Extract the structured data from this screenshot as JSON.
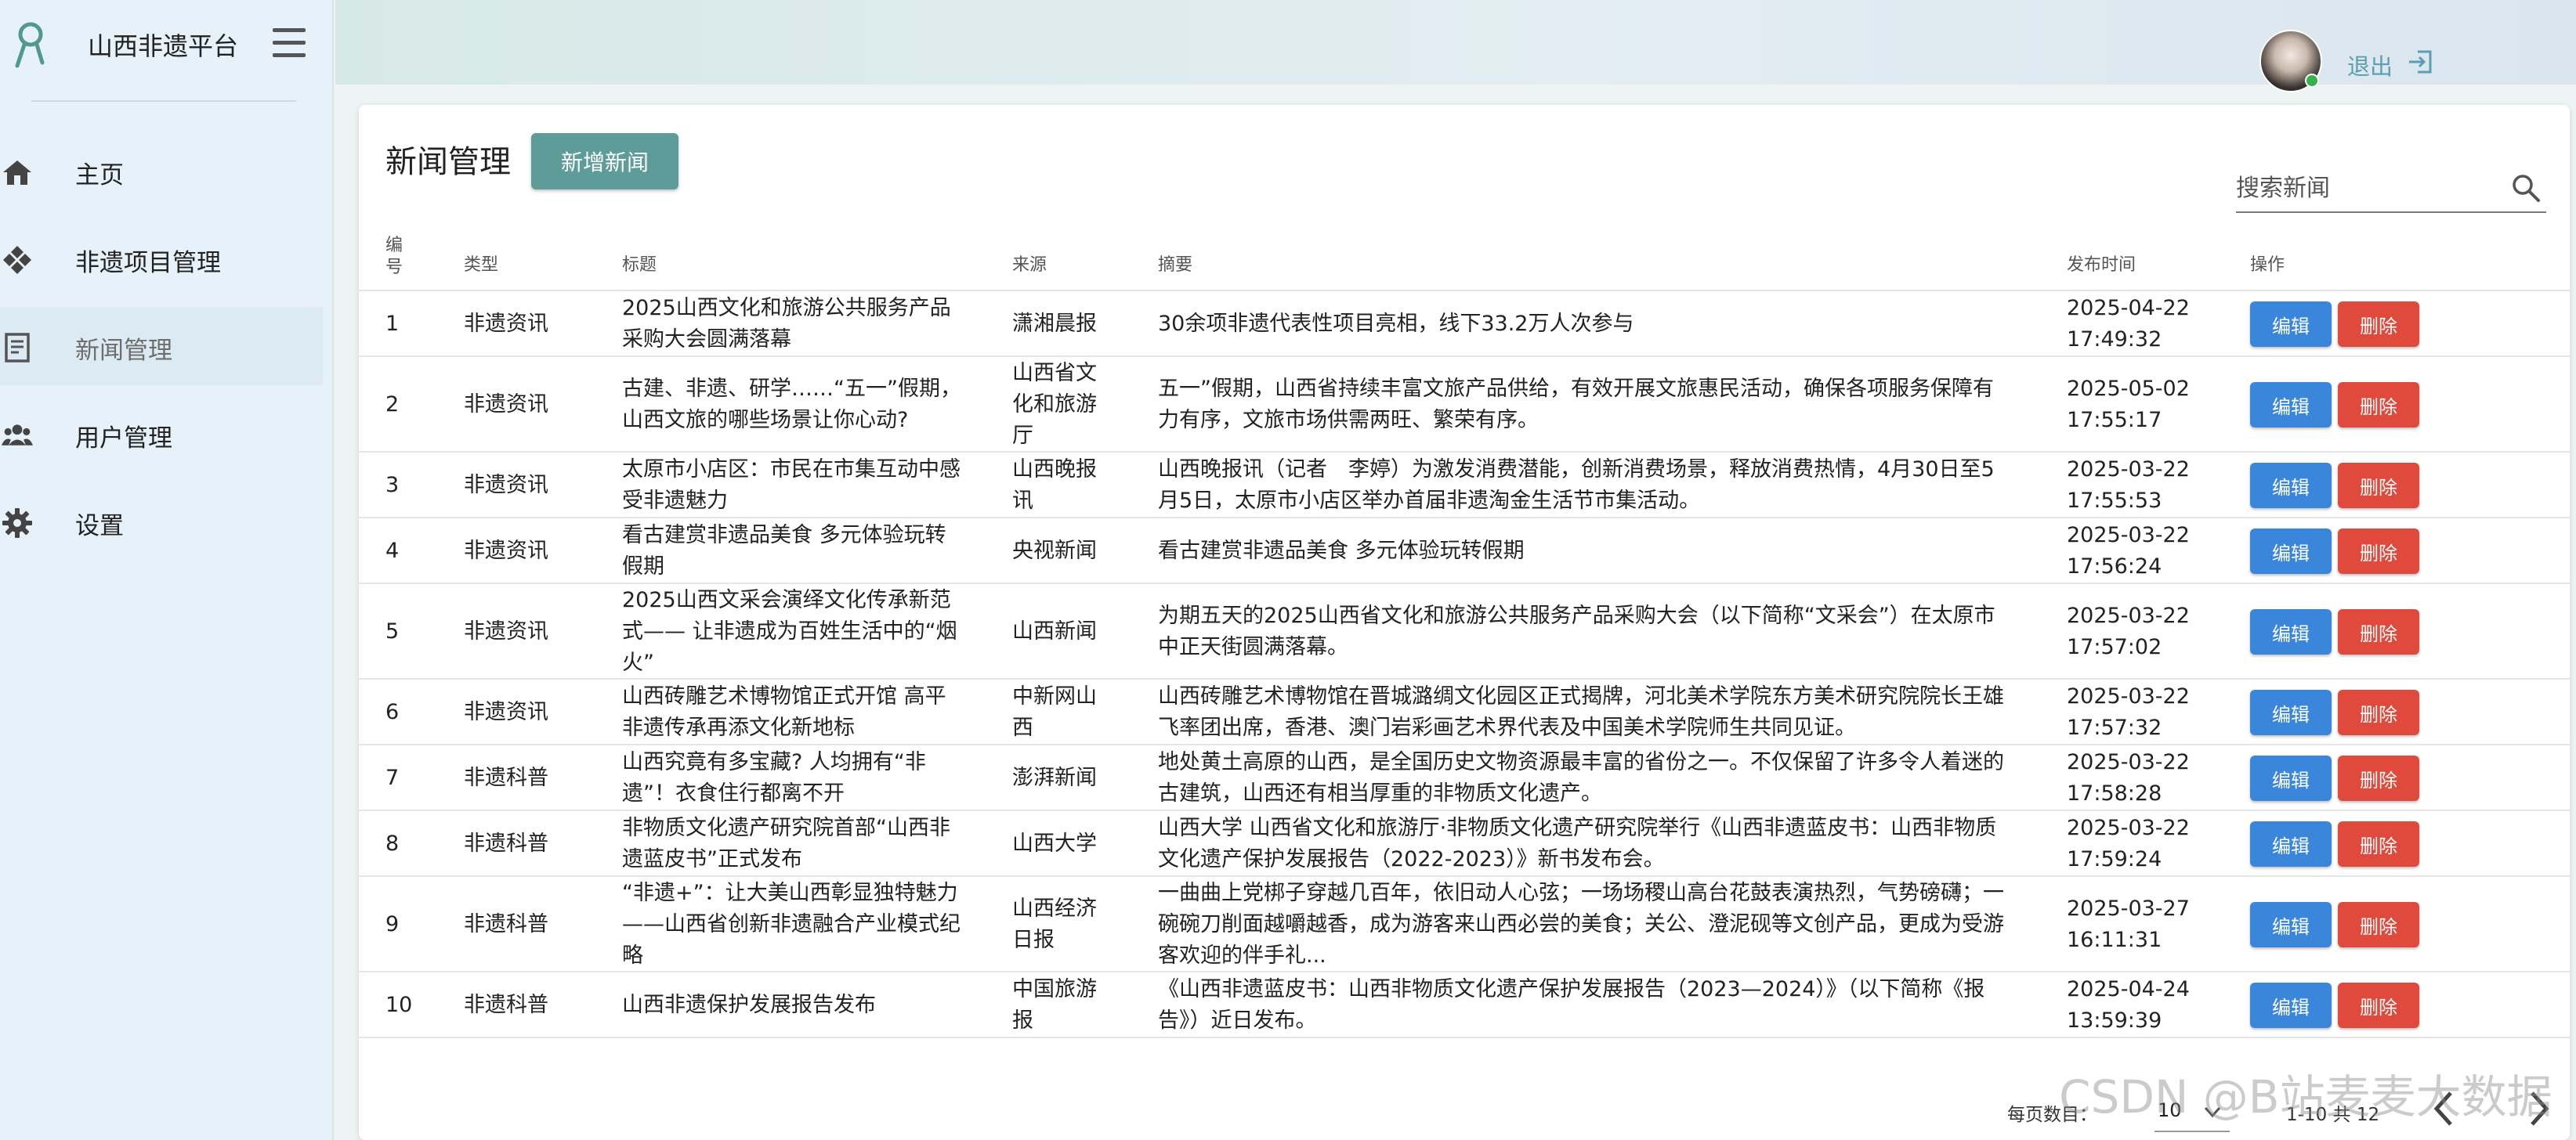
{
  "app": {
    "name": "山西非遗平台"
  },
  "sidebar": {
    "items": [
      {
        "label": "主页",
        "icon": "home-icon"
      },
      {
        "label": "非遗项目管理",
        "icon": "diamond-grid-icon"
      },
      {
        "label": "新闻管理",
        "icon": "news-icon"
      },
      {
        "label": "用户管理",
        "icon": "users-icon"
      },
      {
        "label": "设置",
        "icon": "gear-icon"
      }
    ],
    "active_index": 2
  },
  "topbar": {
    "logout_label": "退出"
  },
  "page": {
    "title": "新闻管理",
    "add_button": "新增新闻",
    "search_placeholder": "搜索新闻"
  },
  "table": {
    "headers": {
      "id": "编号",
      "type": "类型",
      "title": "标题",
      "source": "来源",
      "summary": "摘要",
      "time": "发布时间",
      "ops": "操作"
    },
    "edit_label": "编辑",
    "delete_label": "删除",
    "rows": [
      {
        "id": "1",
        "type": "非遗资讯",
        "title": "2025山西文化和旅游公共服务产品采购大会圆满落幕",
        "source": "潇湘晨报",
        "summary": "30余项非遗代表性项目亮相，线下33.2万人次参与",
        "time": "2025-04-22 17:49:32"
      },
      {
        "id": "2",
        "type": "非遗资讯",
        "title": "古建、非遗、研学……“五一”假期，山西文旅的哪些场景让你心动?",
        "source": "山西省文化和旅游厅",
        "summary": "五一”假期，山西省持续丰富文旅产品供给，有效开展文旅惠民活动，确保各项服务保障有力有序，文旅市场供需两旺、繁荣有序。",
        "time": "2025-05-02 17:55:17"
      },
      {
        "id": "3",
        "type": "非遗资讯",
        "title": "太原市小店区：市民在市集互动中感受非遗魅力",
        "source": "山西晚报讯",
        "summary": "山西晚报讯（记者　李婷）为激发消费潜能，创新消费场景，释放消费热情，4月30日至5月5日，太原市小店区举办首届非遗淘金生活节市集活动。",
        "time": "2025-03-22 17:55:53"
      },
      {
        "id": "4",
        "type": "非遗资讯",
        "title": "看古建赏非遗品美食 多元体验玩转假期",
        "source": "央视新闻",
        "summary": "看古建赏非遗品美食 多元体验玩转假期",
        "time": "2025-03-22 17:56:24"
      },
      {
        "id": "5",
        "type": "非遗资讯",
        "title": "2025山西文采会演绎文化传承新范式—— 让非遗成为百姓生活中的“烟火”",
        "source": "山西新闻",
        "summary": "为期五天的2025山西省文化和旅游公共服务产品采购大会（以下简称“文采会”）在太原市中正天街圆满落幕。",
        "time": "2025-03-22 17:57:02"
      },
      {
        "id": "6",
        "type": "非遗资讯",
        "title": "山西砖雕艺术博物馆正式开馆 高平非遗传承再添文化新地标",
        "source": "中新网山西",
        "summary": "山西砖雕艺术博物馆在晋城潞绸文化园区正式揭牌，河北美术学院东方美术研究院院长王雄飞率团出席，香港、澳门岩彩画艺术界代表及中国美术学院师生共同见证。",
        "time": "2025-03-22 17:57:32"
      },
      {
        "id": "7",
        "type": "非遗科普",
        "title": "山西究竟有多宝藏? 人均拥有“非遗”！衣食住行都离不开",
        "source": "澎湃新闻",
        "summary": "地处黄土高原的山西，是全国历史文物资源最丰富的省份之一。不仅保留了许多令人着迷的古建筑，山西还有相当厚重的非物质文化遗产。",
        "time": "2025-03-22 17:58:28"
      },
      {
        "id": "8",
        "type": "非遗科普",
        "title": "非物质文化遗产研究院首部“山西非遗蓝皮书”正式发布",
        "source": "山西大学",
        "summary": "山西大学 山西省文化和旅游厅·非物质文化遗产研究院举行《山西非遗蓝皮书：山西非物质文化遗产保护发展报告（2022-2023）》新书发布会。",
        "time": "2025-03-22 17:59:24"
      },
      {
        "id": "9",
        "type": "非遗科普",
        "title": "“非遗+”：让大美山西彰显独特魅力——山西省创新非遗融合产业模式纪略",
        "source": "山西经济日报",
        "summary": "一曲曲上党梆子穿越几百年，依旧动人心弦；一场场稷山高台花鼓表演热烈，气势磅礴；一碗碗刀削面越嚼越香，成为游客来山西必尝的美食；关公、澄泥砚等文创产品，更成为受游客欢迎的伴手礼...",
        "time": "2025-03-27 16:11:31"
      },
      {
        "id": "10",
        "type": "非遗科普",
        "title": "山西非遗保护发展报告发布",
        "source": "中国旅游报",
        "summary": "《山西非遗蓝皮书：山西非物质文化遗产保护发展报告（2023—2024）》（以下简称《报告》）近日发布。",
        "time": "2025-04-24 13:59:39"
      }
    ]
  },
  "pagination": {
    "per_page_label": "每页数目：",
    "per_page_value": "10",
    "range_text": "1-10 共 12"
  },
  "watermark": "CSDN @B站麦麦大数据",
  "colors": {
    "primary_teal": "#5d9c98",
    "edit_blue": "#3a86db",
    "delete_red": "#df4a3d",
    "sidebar_bg": "#e6f1f9"
  }
}
